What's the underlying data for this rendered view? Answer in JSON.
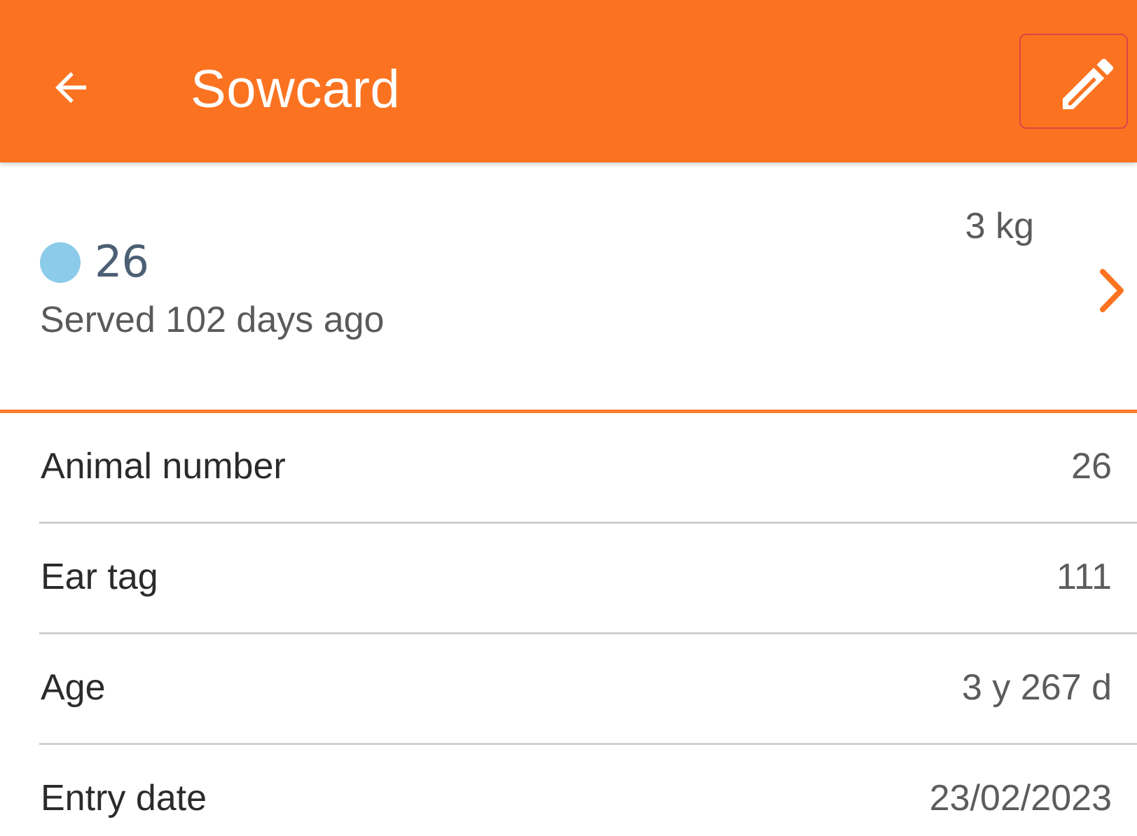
{
  "header": {
    "back_icon": "arrow-left-icon",
    "title": "Sowcard",
    "edit_icon": "pencil-icon",
    "background": "#fb7320"
  },
  "summary": {
    "status_dot_color": "#8ccbe9",
    "animal_number": "26",
    "served_text": "Served 102 days ago",
    "weight": "3 kg",
    "chevron_icon": "chevron-right-icon",
    "accent": "#fb7320"
  },
  "details": [
    {
      "label": "Animal number",
      "value": "26"
    },
    {
      "label": "Ear tag",
      "value": "111"
    },
    {
      "label": "Age",
      "value": "3 y 267 d"
    },
    {
      "label": "Entry date",
      "value": "23/02/2023"
    }
  ]
}
